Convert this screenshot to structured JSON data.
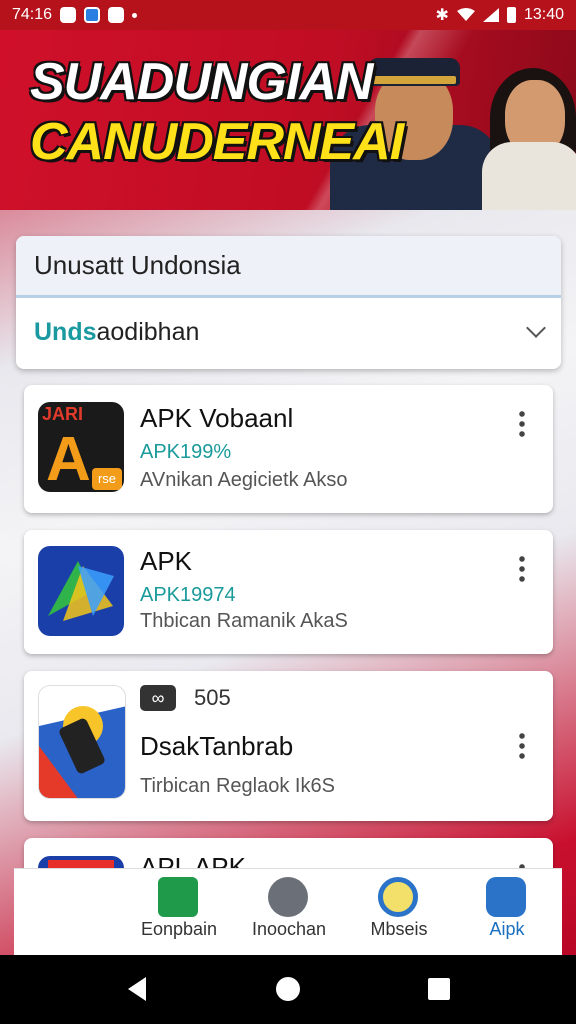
{
  "status_bar": {
    "time_left": "74:16",
    "time_right": "13:40"
  },
  "banner": {
    "line1": "SUADUNGIAN",
    "line2": "CANUDERNEAI"
  },
  "header_card": {
    "title": "Unusatt Undonsia",
    "dropdown_highlight": "Unds",
    "dropdown_rest": "aodibhan"
  },
  "apps": [
    {
      "title": "APK Vobaanl",
      "percent": "APK199%",
      "subtitle": "AVnikan Aegicietk Akso",
      "icon": "letter-a-orange-icon",
      "icon_top": "JARI",
      "icon_tag": "rse"
    },
    {
      "title": "APK",
      "percent": "APK19974",
      "subtitle": "Thbican Ramanik AkaS",
      "icon": "blue-arrow-icon"
    },
    {
      "title": "DsakTanbrab",
      "version": "505",
      "subtitle": "Tirbican Reglaok Ik6S",
      "icon": "phone-sun-icon"
    },
    {
      "title": "APL APK",
      "icon": "letter-a-red-icon"
    }
  ],
  "bottom_nav": [
    {
      "label": "Eonpbain",
      "icon": "green-card-icon"
    },
    {
      "label": "Inoochan",
      "icon": "grey-person-icon"
    },
    {
      "label": "Mbseis",
      "icon": "blue-badge-icon"
    },
    {
      "label": "Aipk",
      "icon": "chat-bubble-icon",
      "active": true
    }
  ],
  "colors": {
    "accent_red": "#c8102e",
    "teal": "#1a9aa0",
    "yellow": "#ffe11a",
    "nav_active": "#1a6fbf"
  }
}
